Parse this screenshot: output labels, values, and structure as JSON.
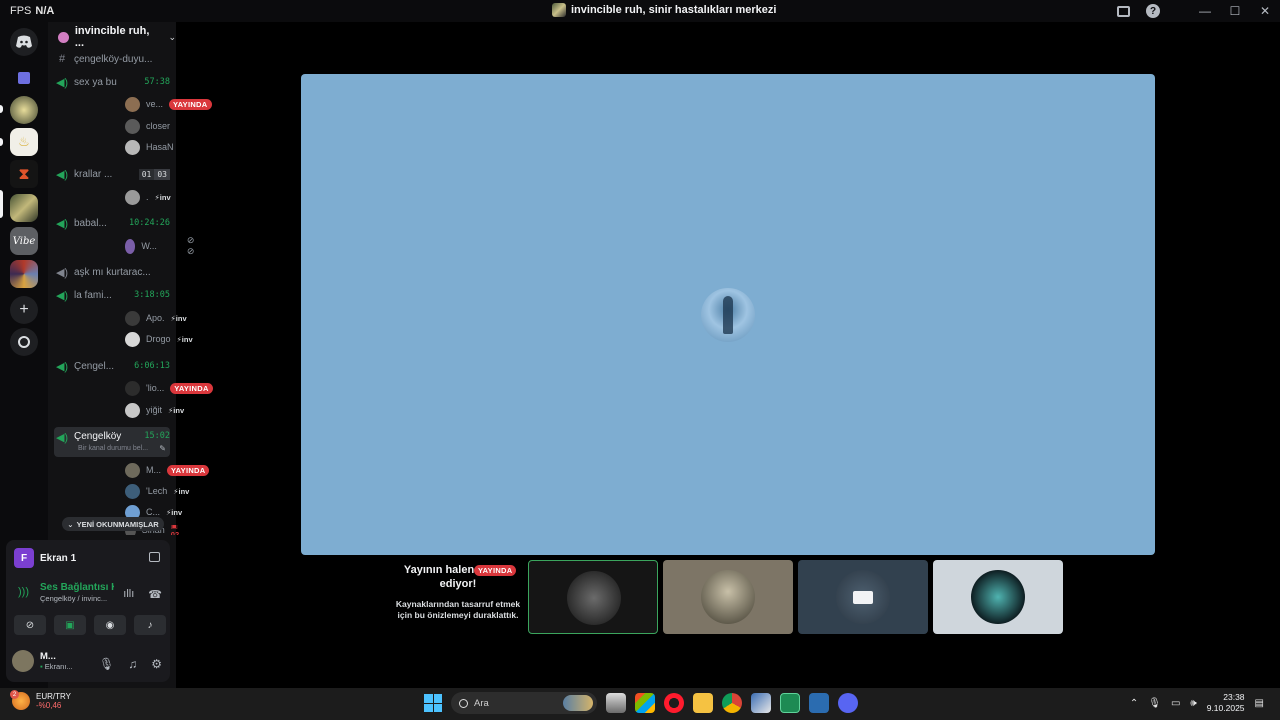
{
  "titlebar": {
    "fps_label": "FPS",
    "fps_value": "N/A",
    "window_title": "invincible ruh, sinir hastalıkları merkezi"
  },
  "server": {
    "name": "invincible ruh, ...",
    "channels": [
      {
        "name": "çengelköy-duyu..."
      },
      {
        "name": "sex ya bu",
        "time": "57:38"
      },
      {
        "name": "krallar ...",
        "count_a": "01",
        "count_b": "03"
      },
      {
        "name": "babal...",
        "time": "10:24:26"
      },
      {
        "name": "aşk mı kurtarac..."
      },
      {
        "name": "la fami...",
        "time": "3:18:05"
      },
      {
        "name": "Çengel...",
        "time": "6:06:13"
      },
      {
        "name": "Çengelköy",
        "time": "15:02",
        "status": "Bir kanal durumu bel..."
      }
    ],
    "users": [
      {
        "name": "ve...",
        "live": "YAYINDA"
      },
      {
        "name": "closer"
      },
      {
        "name": "HasaN"
      },
      {
        "name": ".",
        "tag": "inv"
      },
      {
        "name": "W..."
      },
      {
        "name": "Apo.",
        "tag": "inv"
      },
      {
        "name": "Drogo",
        "tag": "inv"
      },
      {
        "name": "'lio...",
        "live": "YAYINDA"
      },
      {
        "name": "yiğit",
        "tag": "inv"
      },
      {
        "name": "M...",
        "live": "YAYINDA"
      },
      {
        "name": "'Lech",
        "tag": "inv"
      },
      {
        "name": "C...",
        "tag": "inv"
      },
      {
        "name": "Sinan",
        "tag": "02"
      }
    ],
    "unread_label": "YENİ OKUNMAMIŞLAR"
  },
  "panel": {
    "screen_letter": "F",
    "screen_title": "Ekran 1",
    "voice_status": "Ses Bağlantısı K",
    "voice_channel": "Çengelköy / invinc...",
    "user_name": "M...",
    "user_status": "Ekranı..."
  },
  "stage": {
    "paused_title": "Yayının halen devam ediyor!",
    "paused_desc": "Kaynaklarından tasarruf etmek için bu önizlemeyi duraklattık.",
    "live_badge": "YAYINDA"
  },
  "taskbar": {
    "ticker_name": "EUR/TRY",
    "ticker_value": "-%0,46",
    "ticker_badge": "2",
    "search_label": "Ara",
    "time": "23:38",
    "date": "9.10.2025"
  },
  "colors": {
    "stream_bg": "#7eadd1",
    "live_red": "#da373c",
    "voice_green": "#23a55a",
    "selected_border": "#3ba55d"
  }
}
